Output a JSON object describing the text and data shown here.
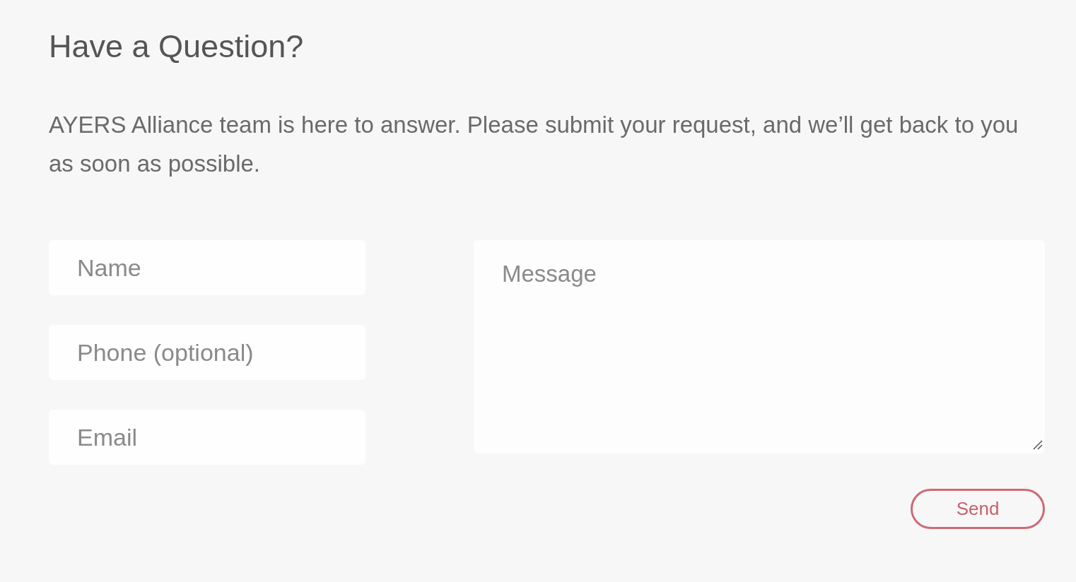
{
  "heading": "Have a Question?",
  "intro": "AYERS Alliance team is here to answer. Please submit your request, and we’ll get back to you as soon as possible.",
  "form": {
    "fields": [
      {
        "placeholder": "Name"
      },
      {
        "placeholder": "Phone (optional)"
      },
      {
        "placeholder": "Email"
      }
    ],
    "message": {
      "placeholder": "Message"
    },
    "submit": "Send"
  }
}
